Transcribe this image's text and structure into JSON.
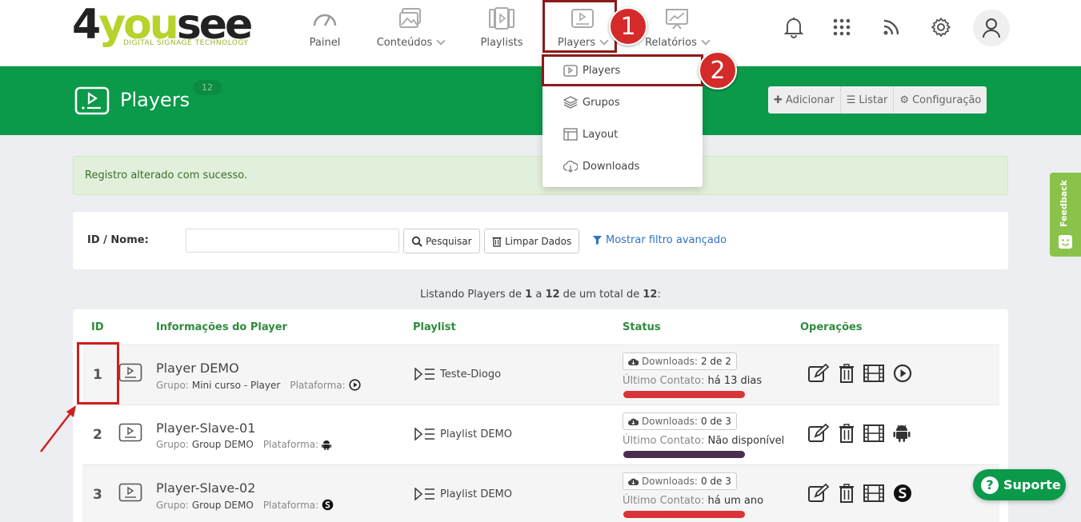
{
  "logo": {
    "brand_a": "4",
    "brand_b": "you",
    "brand_c": "see",
    "tagline": "DIGITAL SIGNAGE TECHNOLOGY"
  },
  "nav": {
    "painel": "Painel",
    "conteudos": "Conteúdos",
    "playlists": "Playlists",
    "players": "Players",
    "relatorios": "Relatórios"
  },
  "annotations": {
    "step1": "1",
    "step2": "2"
  },
  "header": {
    "title": "Players",
    "count": "12",
    "add": "Adicionar",
    "list": "Listar",
    "config": "Configuração"
  },
  "dropdown": {
    "items": [
      "Players",
      "Grupos",
      "Layout",
      "Downloads"
    ]
  },
  "alert": {
    "text": "Registro alterado com sucesso."
  },
  "filter": {
    "label": "ID / Nome:",
    "input_value": "",
    "search": "Pesquisar",
    "clear": "Limpar Dados",
    "advanced": "Mostrar filtro avançado"
  },
  "listing": {
    "prefix": "Listando Players de ",
    "from": "1",
    "mid1": " a ",
    "to": "12",
    "mid2": " de um total de ",
    "total": "12",
    "suffix": ":"
  },
  "table": {
    "headers": {
      "id": "ID",
      "info": "Informações do Player",
      "playlist": "Playlist",
      "status": "Status",
      "ops": "Operações"
    },
    "labels": {
      "group": "Grupo:",
      "platform": "Plataforma:",
      "downloads": "Downloads:",
      "last_contact": "Último Contato:"
    },
    "rows": [
      {
        "id": "1",
        "name": "Player DEMO",
        "group": "Mini curso - Player",
        "platform_icon": "play-circle-icon",
        "playlist": "Teste-Diogo",
        "downloads": "2 de 2",
        "last_contact": "há 13 dias",
        "status_color": "#d9343a"
      },
      {
        "id": "2",
        "name": "Player-Slave-01",
        "group": "Group DEMO",
        "platform_icon": "android-icon",
        "playlist": "Playlist DEMO",
        "downloads": "0 de 3",
        "last_contact": "Não disponível",
        "status_color": "#4a2f4d"
      },
      {
        "id": "3",
        "name": "Player-Slave-02",
        "group": "Group DEMO",
        "platform_icon": "samsung-s-icon",
        "playlist": "Playlist DEMO",
        "downloads": "0 de 3",
        "last_contact": "há um ano",
        "status_color": "#d9343a"
      }
    ]
  },
  "feedback": {
    "label": "Feedback"
  },
  "support": {
    "label": "Suporte",
    "icon": "?"
  },
  "colors": {
    "green": "#0a9a4a",
    "annotation_red": "#d01e1e",
    "header_text_green": "#2e8b3e"
  }
}
